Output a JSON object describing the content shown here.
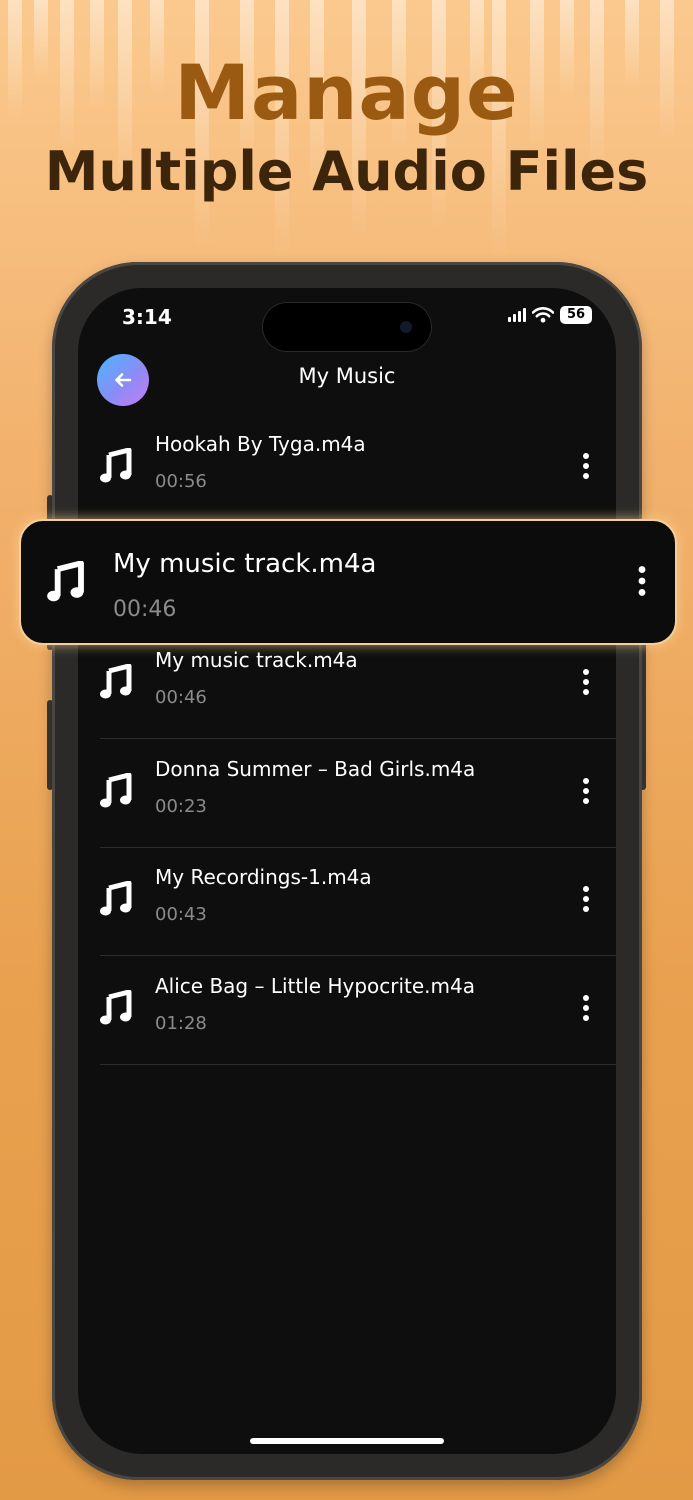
{
  "promo": {
    "headline": "Manage",
    "subheadline": "Multiple Audio Files"
  },
  "status_bar": {
    "time": "3:14",
    "battery": "56"
  },
  "header": {
    "title": "My Music"
  },
  "highlighted_track": {
    "name": "My music track.m4a",
    "duration": "00:46"
  },
  "tracks": [
    {
      "name": "Hookah By Tyga.m4a",
      "duration": "00:56"
    },
    {
      "name": "My music track.m4a",
      "duration": "00:46"
    },
    {
      "name": "Donna Summer – Bad Girls.m4a",
      "duration": "00:23"
    },
    {
      "name": "My Recordings-1.m4a",
      "duration": "00:43"
    },
    {
      "name": "Alice Bag – Little Hypocrite.m4a",
      "duration": "01:28"
    }
  ],
  "icons": {
    "back": "arrow-left-icon",
    "track": "music-note-icon",
    "more": "more-vertical-icon"
  },
  "colors": {
    "accent_gradient_start": "#4ab6ff",
    "accent_gradient_end": "#c87bf2",
    "headline": "#9a5a12",
    "subheadline": "#3c250b",
    "screen_background": "#0e0e0e",
    "highlight_border": "#f5cf98"
  }
}
